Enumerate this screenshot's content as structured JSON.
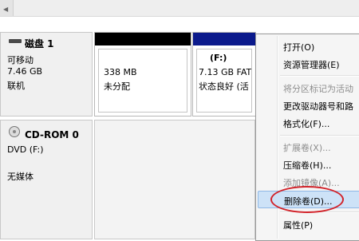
{
  "disks": [
    {
      "title": "磁盘 1",
      "type": "可移动",
      "size": "7.46 GB",
      "status": "联机",
      "partitions": [
        {
          "size": "338 MB",
          "status": "未分配"
        },
        {
          "name": "(F:)",
          "size": "7.13 GB FAT",
          "status": "状态良好 (活"
        }
      ]
    },
    {
      "title": "CD-ROM 0",
      "type": "DVD (F:)",
      "status": "无媒体"
    }
  ],
  "context_menu": {
    "items": [
      {
        "label": "打开(O)",
        "enabled": true
      },
      {
        "label": "资源管理器(E)",
        "enabled": true
      },
      {
        "label": "将分区标记为活动",
        "enabled": false
      },
      {
        "label": "更改驱动器号和路",
        "enabled": true
      },
      {
        "label": "格式化(F)...",
        "enabled": true
      },
      {
        "label": "扩展卷(X)...",
        "enabled": false
      },
      {
        "label": "压缩卷(H)...",
        "enabled": true
      },
      {
        "label": "添加镜像(A)...",
        "enabled": false
      },
      {
        "label": "删除卷(D)...",
        "enabled": true,
        "selected": true
      },
      {
        "label": "属性(P)",
        "enabled": true
      }
    ]
  },
  "colors": {
    "unallocated_bar": "#000000",
    "primary_bar": "#0b1a8c",
    "menu_selection": "#cde2f7",
    "annotation_ellipse": "#d2232a"
  }
}
